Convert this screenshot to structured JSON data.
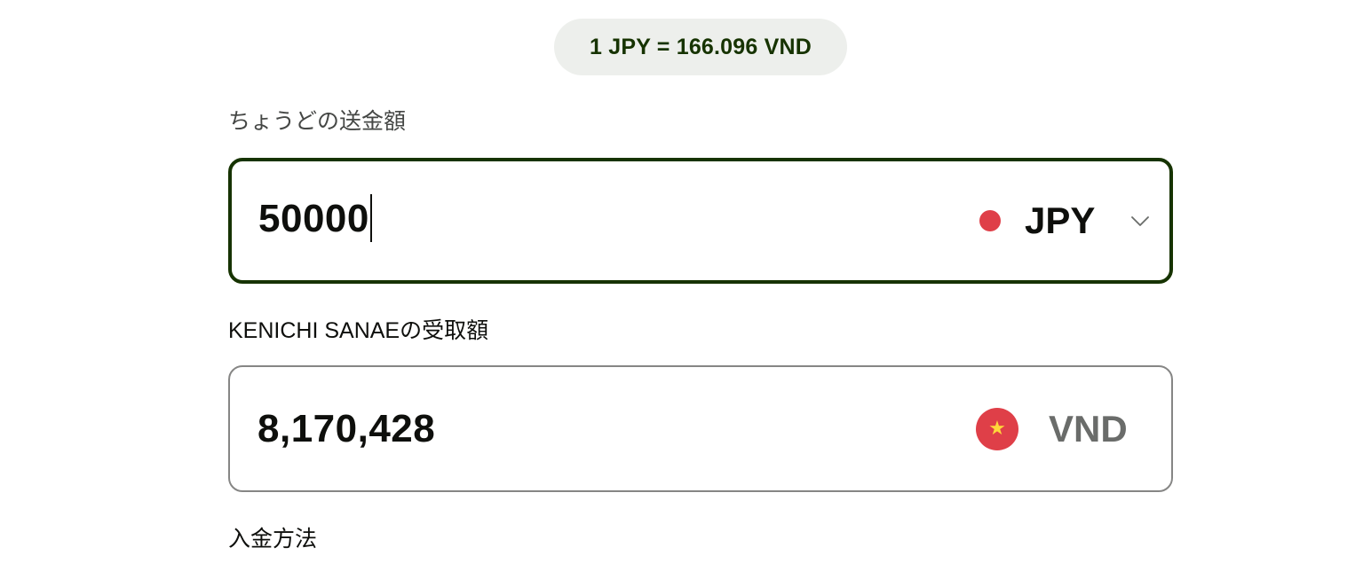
{
  "rate": {
    "text": "1 JPY = 166.096 VND"
  },
  "send": {
    "label": "ちょうどの送金額",
    "value": "50000",
    "currency_code": "JPY",
    "flag_icon": "japan-flag-icon",
    "flag_color": "#df3f48",
    "dropdown_icon": "chevron-down-icon"
  },
  "receive": {
    "label": "KENICHI SANAEの受取額",
    "value": "8,170,428",
    "currency_code": "VND",
    "flag_icon": "vietnam-flag-icon",
    "flag_color": "#df3f48",
    "flag_star": "★"
  },
  "payment": {
    "label": "入金方法"
  },
  "colors": {
    "accent_dark_green": "#163300",
    "pill_background": "#edefec",
    "readonly_border": "#868685",
    "muted_text": "#6a6c6a"
  }
}
